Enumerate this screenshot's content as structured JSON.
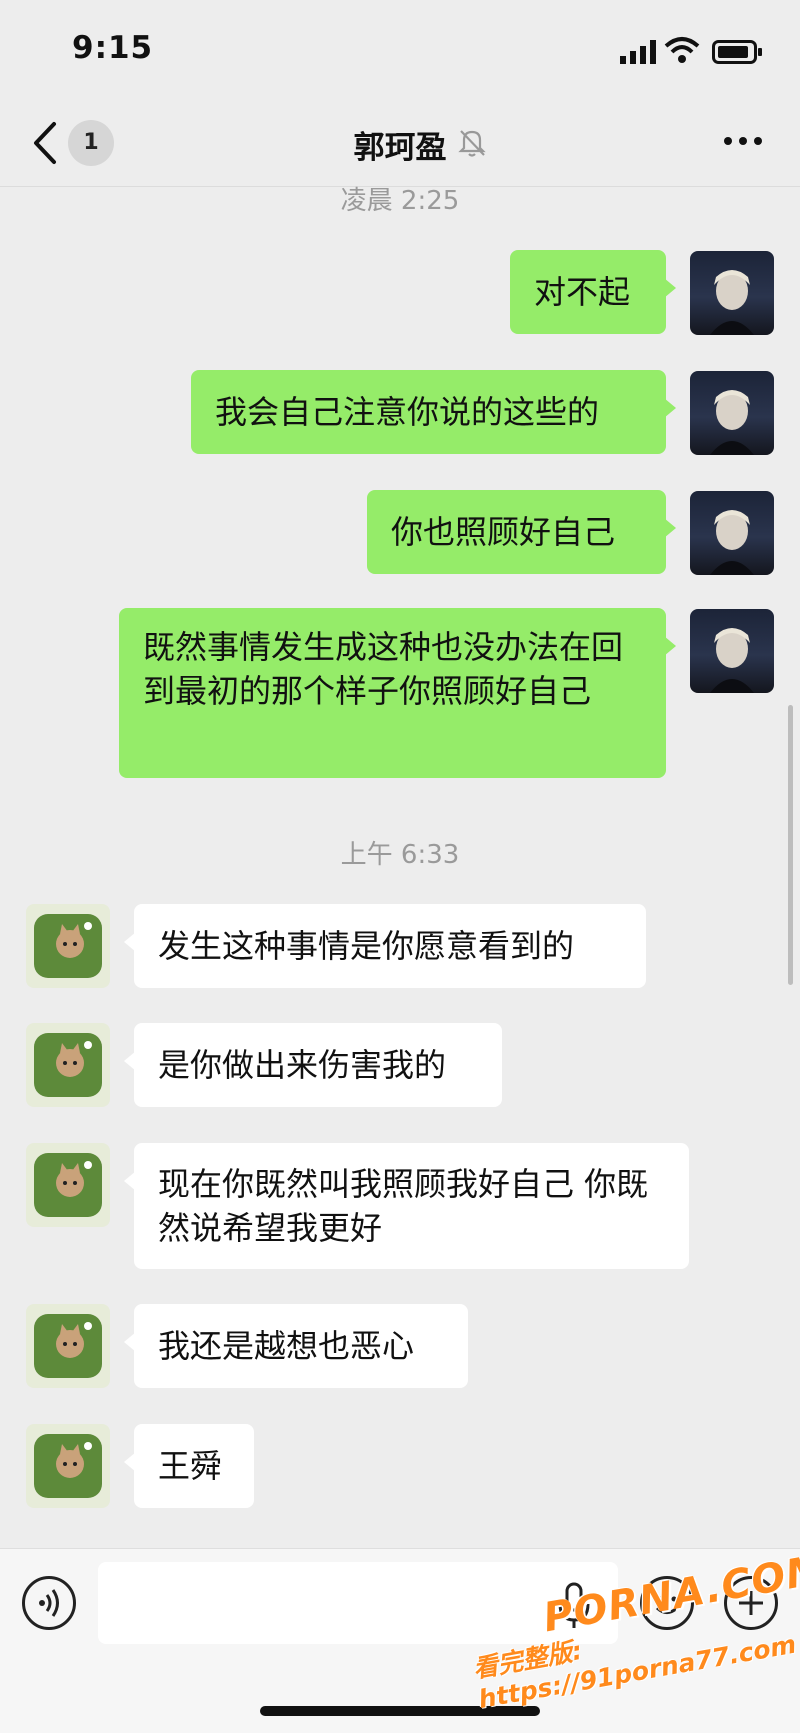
{
  "status_bar": {
    "time": "9:15"
  },
  "nav": {
    "title": "郭珂盈",
    "unread_count": "1"
  },
  "chat": {
    "timestamps": [
      "凌晨 2:25",
      "上午 6:33"
    ],
    "outgoing": [
      "对不起",
      "我会自己注意你说的这些的",
      "你也照顾好自己",
      "既然事情发生成这种也没办法在回到最初的那个样子你照顾好自己"
    ],
    "incoming": [
      "发生这种事情是你愿意看到的",
      "是你做出来伤害我的",
      "现在你既然叫我照顾我好自己 你既然说希望我更好",
      "我还是越想也恶心",
      "王舜"
    ]
  },
  "watermark": {
    "main": "PORNA.COM",
    "sub": "看完整版: https://91porna77.com"
  },
  "icons": [
    "back-arrow-icon",
    "mute-bell-icon",
    "more-dots-icon",
    "voice-icon",
    "microphone-icon",
    "emoji-icon",
    "plus-icon",
    "signal-icon",
    "wifi-icon",
    "battery-icon"
  ],
  "colors": {
    "outgoing_bubble": "#95ec69",
    "incoming_bubble": "#ffffff",
    "background": "#ededed",
    "watermark": "#ff8a1c"
  }
}
